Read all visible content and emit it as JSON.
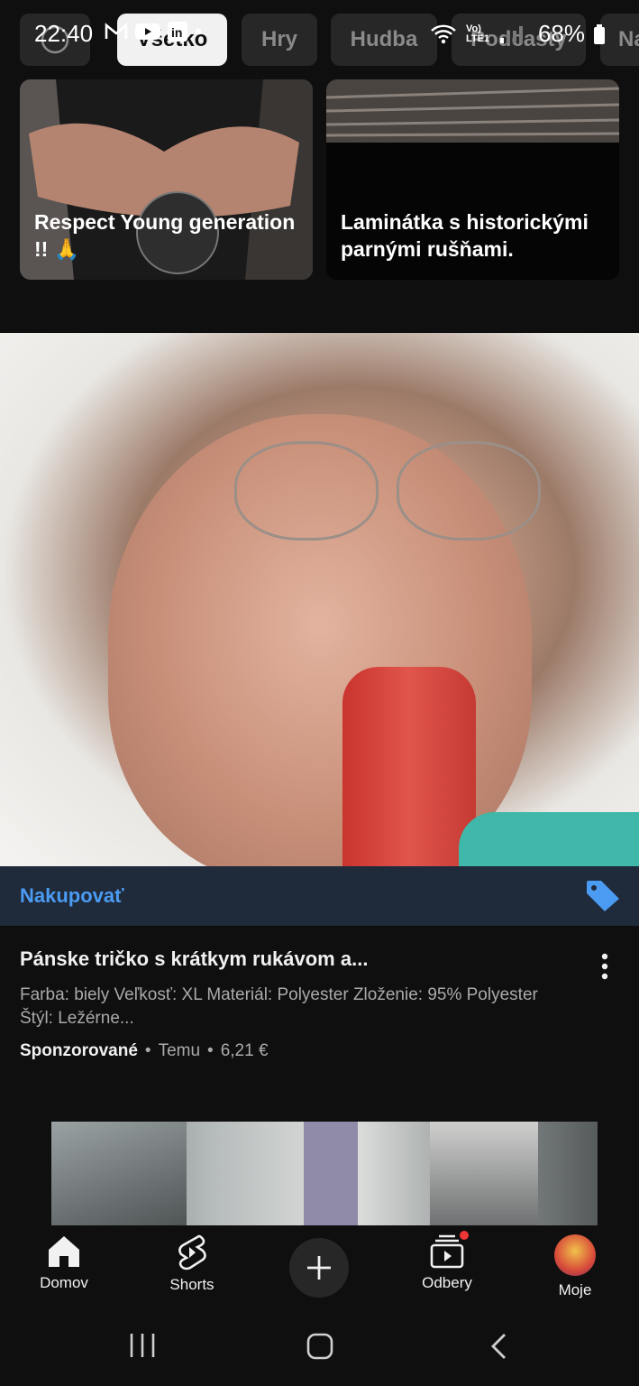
{
  "status_bar": {
    "time": "22:40",
    "battery": "68%",
    "network": "Vo) LTE1",
    "roaming": "R"
  },
  "chips": [
    {
      "label": "",
      "selected": false
    },
    {
      "label": "Všetko",
      "selected": true
    },
    {
      "label": "Hry",
      "selected": false
    },
    {
      "label": "Hudba",
      "selected": false
    },
    {
      "label": "Podcasty",
      "selected": false
    },
    {
      "label": "Na",
      "selected": false
    }
  ],
  "shorts": [
    {
      "title": "Respect Young generation !! 🙏"
    },
    {
      "title": "Laminátka s historickými parnými rušňami."
    }
  ],
  "ad": {
    "shop_label": "Nakupovať",
    "title": "Pánske tričko s krátkym rukávom a...",
    "description": "Farba: biely Veľkosť: XL Materiál: Polyester Zloženie: 95% Polyester Štýl: Ležérne...",
    "sponsored": "Sponzorované",
    "advertiser": "Temu",
    "price": "6,21 €",
    "separator": "•"
  },
  "bottom_nav": {
    "home": "Domov",
    "shorts": "Shorts",
    "subscriptions": "Odbery",
    "you": "Moje"
  },
  "colors": {
    "background": "#0f0f0f",
    "shop_bar": "#1f2a3a",
    "accent_blue": "#4b9bf2",
    "notification": "#f03535"
  }
}
